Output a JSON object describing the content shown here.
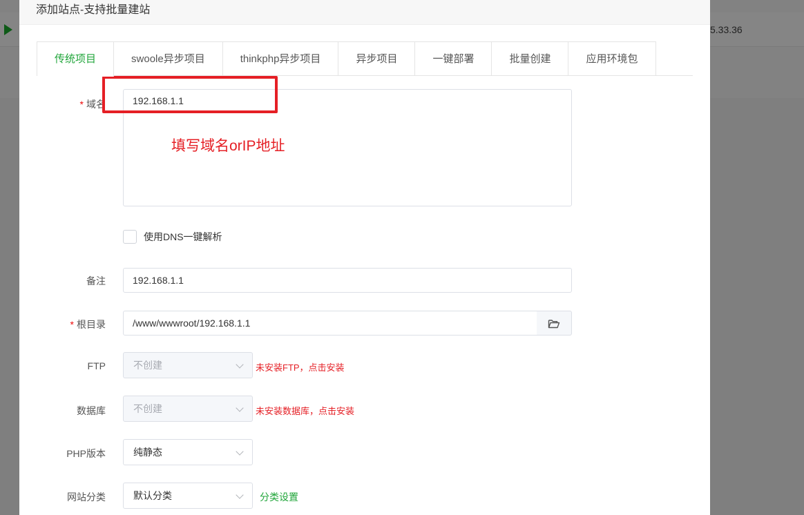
{
  "background": {
    "ip_fragment": "5.33.36"
  },
  "dialog": {
    "title": "添加站点-支持批量建站"
  },
  "tabs": [
    {
      "label": "传统项目",
      "active": true
    },
    {
      "label": "swoole异步项目"
    },
    {
      "label": "thinkphp异步项目"
    },
    {
      "label": "异步项目"
    },
    {
      "label": "一键部署"
    },
    {
      "label": "批量创建"
    },
    {
      "label": "应用环境包"
    }
  ],
  "form": {
    "domain": {
      "label": "域名",
      "value": "192.168.1.1"
    },
    "annotation": "填写域名orIP地址",
    "dns": {
      "label": "使用DNS一键解析",
      "checked": false
    },
    "remark": {
      "label": "备注",
      "value": "192.168.1.1"
    },
    "root": {
      "label": "根目录",
      "value": "/www/wwwroot/192.168.1.1"
    },
    "ftp": {
      "label": "FTP",
      "value": "不创建",
      "note": "未安装FTP，点击安装"
    },
    "database": {
      "label": "数据库",
      "value": "不创建",
      "note": "未安装数据库，点击安装"
    },
    "php": {
      "label": "PHP版本",
      "value": "纯静态"
    },
    "category": {
      "label": "网站分类",
      "value": "默认分类",
      "link": "分类设置"
    }
  },
  "colors": {
    "accent": "#20a53a",
    "warning": "#e51f25",
    "required": "#ef0808"
  }
}
